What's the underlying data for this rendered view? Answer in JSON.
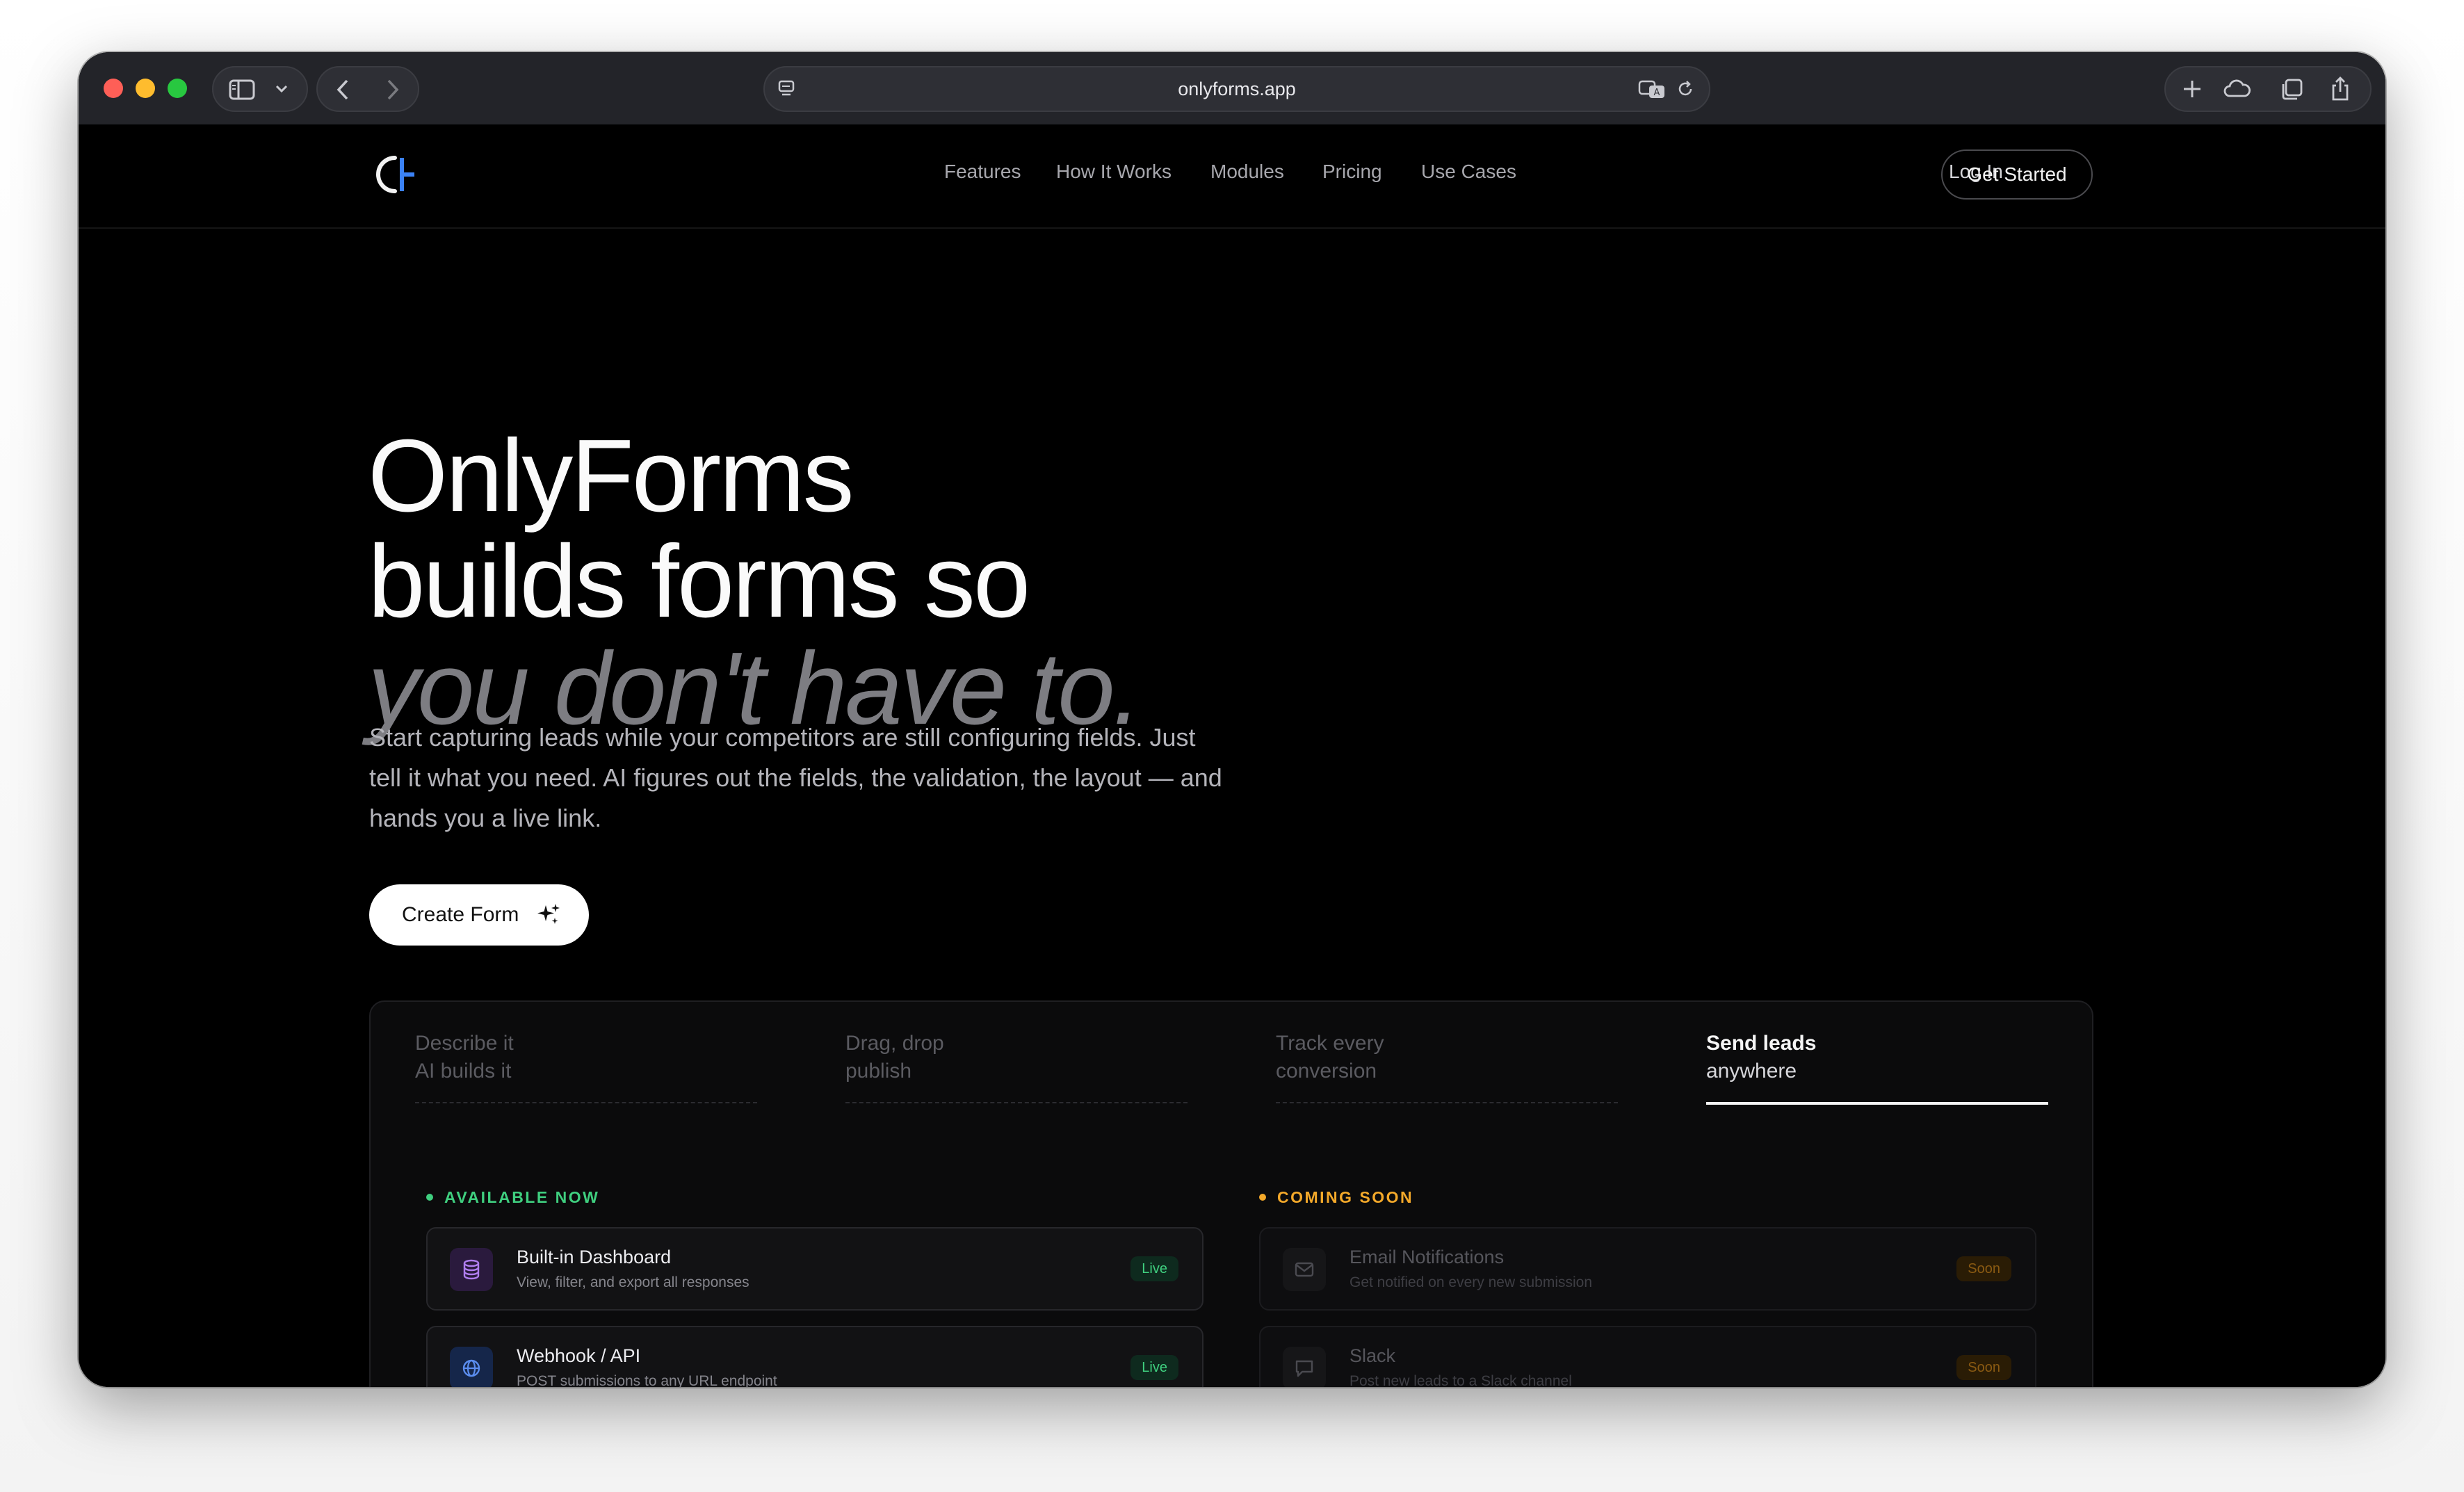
{
  "browser": {
    "url": "onlyforms.app"
  },
  "nav": {
    "links": [
      "Features",
      "How It Works",
      "Modules",
      "Pricing",
      "Use Cases"
    ],
    "login": "Log In",
    "get_started": "Get Started"
  },
  "hero": {
    "line1": "OnlyForms",
    "line2": "builds forms so",
    "line3": "you don't have to.",
    "subtitle": "Start capturing leads while your competitors are still configuring fields. Just tell it what you need. AI figures out the fields, the validation, the layout — and hands you a live link.",
    "cta": "Create Form"
  },
  "tabs": [
    {
      "line1": "Describe it",
      "line2": "AI builds it"
    },
    {
      "line1": "Drag, drop",
      "line2": "publish"
    },
    {
      "line1": "Track every",
      "line2": "conversion"
    },
    {
      "line1": "Send leads",
      "line2": "anywhere"
    }
  ],
  "available": {
    "label": "AVAILABLE NOW",
    "items": [
      {
        "title": "Built-in Dashboard",
        "desc": "View, filter, and export all responses",
        "badge": "Live"
      },
      {
        "title": "Webhook / API",
        "desc": "POST submissions to any URL endpoint",
        "badge": "Live"
      }
    ]
  },
  "coming": {
    "label": "COMING SOON",
    "items": [
      {
        "title": "Email Notifications",
        "desc": "Get notified on every new submission",
        "badge": "Soon"
      },
      {
        "title": "Slack",
        "desc": "Post new leads to a Slack channel",
        "badge": "Soon"
      }
    ]
  },
  "colors": {
    "available_green": "#3fcf7f",
    "coming_amber": "#f4a92a",
    "logo_blue": "#3b82f6"
  }
}
